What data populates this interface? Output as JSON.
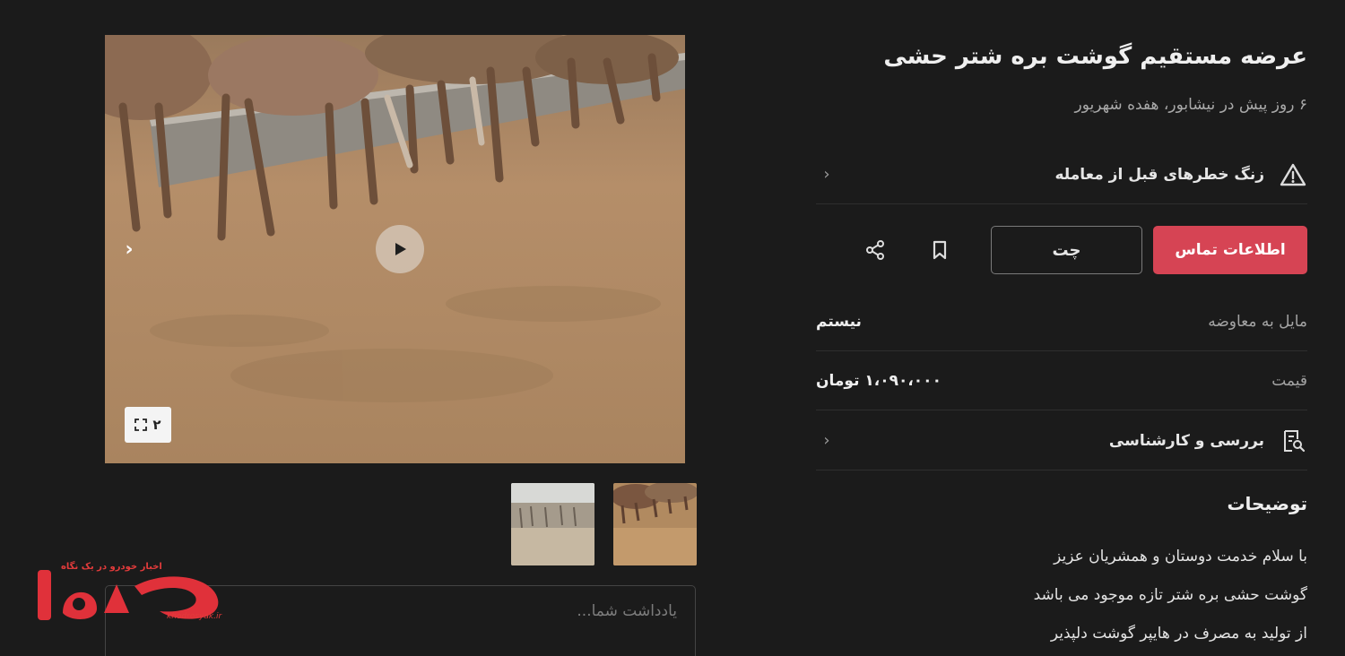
{
  "listing": {
    "title": "عرضه مستقیم گوشت بره شتر حشی",
    "subtitle": "۶ روز پیش در نیشابور، هفده شهریور"
  },
  "risk_row": {
    "label": "زنگ خطرهای قبل از معامله",
    "icon": "warning-triangle-icon"
  },
  "actions": {
    "contact_label": "اطلاعات تماس",
    "chat_label": "چت",
    "contact_color": "#d64454"
  },
  "attributes": [
    {
      "key": "مایل به معاوضه",
      "value": "نیستم"
    },
    {
      "key": "قیمت",
      "value": "۱،۰۹۰،۰۰۰ تومان"
    }
  ],
  "review_row": {
    "label": "بررسی و کارشناسی",
    "icon": "document-search-icon"
  },
  "description": {
    "title": "توضیحات",
    "lines": [
      "با سلام خدمت دوستان و همشریان عزیز",
      "گوشت حشی بره شتر تازه موجود می باشد",
      "از تولید به مصرف در هایپر گوشت دلپذیر"
    ]
  },
  "gallery": {
    "image_count": "۲",
    "note_placeholder": "یادداشت شما..."
  },
  "watermark": {
    "tagline": "اخبار خودرو در یک نگاه",
    "name": "خودرو",
    "url": "khodrosyak.ir"
  }
}
